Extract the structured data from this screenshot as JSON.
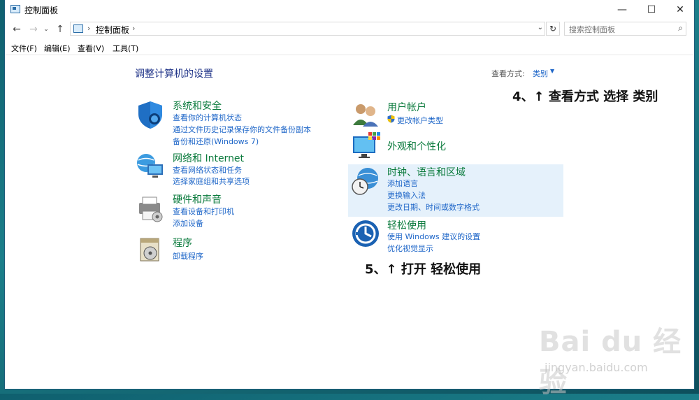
{
  "window": {
    "title": "控制面板",
    "buttons": {
      "minimize": "—",
      "maximize": "☐",
      "close": "✕"
    }
  },
  "navigation": {
    "back": "←",
    "forward": "→",
    "recent": "⌄",
    "up": "↑",
    "address": "控制面板",
    "refresh": "↻",
    "search_placeholder": "搜索控制面板",
    "search_icon": "⌕"
  },
  "menu": [
    "文件(F)",
    "编辑(E)",
    "查看(V)",
    "工具(T)"
  ],
  "main": {
    "heading": "调整计算机的设置",
    "view_by_label": "查看方式:",
    "view_by_value": "类别"
  },
  "categories": {
    "system_security": {
      "title": "系统和安全",
      "links": [
        "查看你的计算机状态",
        "通过文件历史记录保存你的文件备份副本",
        "备份和还原(Windows 7)"
      ]
    },
    "network": {
      "title": "网络和 Internet",
      "links": [
        "查看网络状态和任务",
        "选择家庭组和共享选项"
      ]
    },
    "hardware": {
      "title": "硬件和声音",
      "links": [
        "查看设备和打印机",
        "添加设备"
      ]
    },
    "programs": {
      "title": "程序",
      "links": [
        "卸载程序"
      ]
    },
    "user_accounts": {
      "title": "用户帐户",
      "links": [
        "更改帐户类型"
      ]
    },
    "appearance": {
      "title": "外观和个性化"
    },
    "clock_region": {
      "title": "时钟、语言和区域",
      "links": [
        "添加语言",
        "更换输入法",
        "更改日期、时间或数字格式"
      ]
    },
    "ease_of_access": {
      "title": "轻松使用",
      "links": [
        "使用 Windows 建议的设置",
        "优化视觉显示"
      ]
    }
  },
  "annotations": {
    "note4": "4、↑  查看方式 选择 类别",
    "note5": "5、↑  打开 轻松使用"
  },
  "watermark": {
    "main": "Bai du 经验",
    "sub": "jingyan.baidu.com"
  },
  "colors": {
    "category_title": "#0a7a3c",
    "link": "#1e66c8",
    "heading": "#1e3287",
    "highlight": "#e5f1fb"
  }
}
